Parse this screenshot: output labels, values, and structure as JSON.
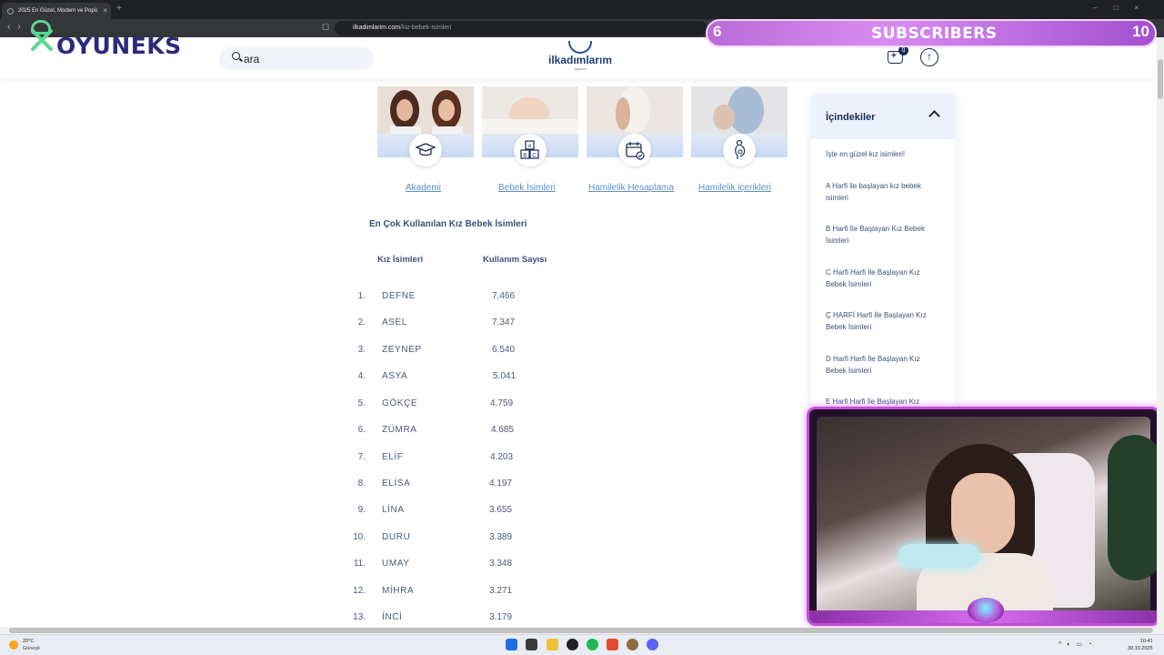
{
  "browser": {
    "tab_title": "2025 En Güzel, Modern ve Popü",
    "tab_close": "×",
    "new_tab": "+",
    "url_domain": "ilkadimlarim.com",
    "url_path": "/kiz-bebek-isimleri"
  },
  "overlay": {
    "logo_text": "OYUNEKS",
    "subs_count": "6",
    "subs_label": "SUBSCRIBERS",
    "subs_goal": "10"
  },
  "header": {
    "search_placeholder": "ara",
    "brand_name": "ilkadımlarım",
    "brand_sub": "Aptamil",
    "cart_count": "0",
    "up_arrow": "↑"
  },
  "cards": [
    {
      "label": "Akademi",
      "icon": "graduation-cap-icon"
    },
    {
      "label": "Bebek İsimleri",
      "icon": "abc-blocks-icon"
    },
    {
      "label": "Hamilelik Hesaplama",
      "icon": "calendar-icon"
    },
    {
      "label": "Hamilelik içerikleri",
      "icon": "pregnant-woman-icon"
    }
  ],
  "table": {
    "title": "En Çok Kullanılan Kız Bebek İsimleri",
    "col_name": "Kız İsimleri",
    "col_count": "Kullanım Sayısı",
    "rows": [
      {
        "no": "1.",
        "name": "DEFNE",
        "count": "7.466"
      },
      {
        "no": "2.",
        "name": "ASEL",
        "count": "7.347"
      },
      {
        "no": "3.",
        "name": "ZEYNEP",
        "count": "6.540"
      },
      {
        "no": "4.",
        "name": "ASYA",
        "count": "5.041"
      },
      {
        "no": "5.",
        "name": "GÖKÇE",
        "count": "4.759"
      },
      {
        "no": "6.",
        "name": "ZÜMRA",
        "count": "4.685"
      },
      {
        "no": "7.",
        "name": "ELİF",
        "count": "4.203"
      },
      {
        "no": "8.",
        "name": "ELİSA",
        "count": "4.197"
      },
      {
        "no": "9.",
        "name": "LİNA",
        "count": "3.655"
      },
      {
        "no": "10.",
        "name": "DURU",
        "count": "3.389"
      },
      {
        "no": "11.",
        "name": "UMAY",
        "count": "3.348"
      },
      {
        "no": "12.",
        "name": "MİHRA",
        "count": "3.271"
      },
      {
        "no": "13.",
        "name": "İNCİ",
        "count": "3.179"
      }
    ]
  },
  "toc": {
    "title": "İçindekiler",
    "items": [
      "İşte en güzel kız isimleri!",
      "A Harfi ile başlayan kız bebek isimleri",
      "B Harfi İle Başlayan Kız Bebek İsimleri",
      "C Harfi Harfi İle Başlayan Kız Bebek İsimleri",
      "Ç HARFİ Harfi İle Başlayan Kız Bebek İsimleri",
      "D Harfi Harfi İle Başlayan Kız Bebek İsimleri",
      "E Harfi Harfi İle Başlayan Kız"
    ]
  },
  "taskbar": {
    "temp": "20°C",
    "weather": "Güneşli",
    "time": "10:41",
    "date": "30.10.2025"
  }
}
